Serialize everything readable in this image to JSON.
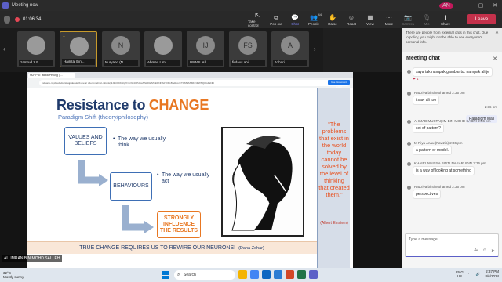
{
  "window": {
    "title": "Meeting now",
    "avatar_initials": "AN",
    "controls": [
      "—",
      "▢",
      "✕"
    ]
  },
  "toolbar": {
    "timer": "01:06:34",
    "buttons": [
      {
        "label": "Take control",
        "icon": "take-control-icon",
        "glyph": "⇱"
      },
      {
        "label": "Pop out",
        "icon": "pop-out-icon",
        "glyph": "⧉"
      },
      {
        "label": "Chat",
        "icon": "chat-icon",
        "glyph": "💬",
        "active": true
      },
      {
        "label": "People",
        "icon": "people-icon",
        "glyph": "👥",
        "badge": "44"
      },
      {
        "label": "Raise",
        "icon": "raise-hand-icon",
        "glyph": "✋"
      },
      {
        "label": "React",
        "icon": "react-icon",
        "glyph": "☺"
      },
      {
        "label": "View",
        "icon": "view-icon",
        "glyph": "▦"
      },
      {
        "label": "More",
        "icon": "more-icon",
        "glyph": "⋯"
      },
      {
        "label": "Camera",
        "icon": "camera-icon",
        "glyph": "📷",
        "dim": true
      },
      {
        "label": "Mic",
        "icon": "mic-icon",
        "glyph": "🎙",
        "dim": true
      },
      {
        "label": "Share",
        "icon": "share-icon",
        "glyph": "⬆"
      }
    ],
    "leave_label": "Leave"
  },
  "participants": [
    {
      "name": "zamrud Z.F...",
      "initials": "",
      "speaking": false
    },
    {
      "name": "Hairizal Bin...",
      "initials": "",
      "speaking": true,
      "hand": "1"
    },
    {
      "name": "Nuryahd (N...",
      "initials": "N",
      "speaking": false
    },
    {
      "name": "Ahmad Lim...",
      "initials": "",
      "speaking": false
    },
    {
      "name": "ISMAIL All...",
      "initials": "IJ",
      "speaking": false
    },
    {
      "name": "firdaus abi...",
      "initials": "FS",
      "speaking": false
    },
    {
      "name": "Azhari",
      "initials": "A",
      "speaking": false
    }
  ],
  "browser": {
    "tab": "NUYPro: Istiwa Perung | ...",
    "url": "ndeans-mycloudedutrstaqpidecuiwtb.meta/ odenpn.ehmz-mfonts/j3JZb0OtK.zip?cm=9c4CPdmsNSLR4/TZmbDNNA0TON-BSdtpo==TOMWIZIMNNDWSQOG4ENH",
    "button": "Use Document Editor"
  },
  "slide": {
    "title_main": "Resistance to ",
    "title_accent": "CHANGE",
    "subtitle": "Paradigm Shift (theory/philosophy)",
    "box1": "VALUES AND BELIEFS",
    "bullet1": "The way we usually think",
    "box2": "BEHAVIOURS",
    "bullet2": "The way we usually act",
    "box3_line1": "STRONGLY",
    "box3_line2": "INFLUENCE",
    "box3_line3": "THE RESULTS",
    "quote": "“The problems that exist in the world today cannot be solved by the level of thinking that created them.”",
    "quote_author": "(Albert Einstein)",
    "banner": "TRUE CHANGE REQUIRES US TO REWIRE OUR NEURONS!",
    "banner_author": "(Dana Zohar)"
  },
  "presenter": "AU IMRAN BIN MOHD SALLEH",
  "side": {
    "notice": "There are people from external orgs in this chat. Due to policy, you might not be able to see everyone's personal info.",
    "chat_title": "Meeting chat",
    "messages": [
      {
        "sender": "",
        "time": "",
        "text": "saya tak nampak gambar tu. nampak ali je",
        "reaction": "❤ 1"
      },
      {
        "sender": "Radziva binti Mohamed",
        "time": "2:35 pm",
        "text": "i saw ali too"
      },
      {
        "sender": "",
        "time": "2:36 pm",
        "text": "Paradigm Mall",
        "self": true
      },
      {
        "sender": "AHMAD MUSTAQIM BIN MOHD SABRI",
        "time": "2:36 pm",
        "text": "set of pattern?"
      },
      {
        "sender": "M Riya Anau (Fawzia)",
        "time": "2:36 pm",
        "text": "a pattern or model."
      },
      {
        "sender": "KHAIRUNNISSA BINTI NASARUDIN",
        "time": "2:36 pm",
        "text": "is a way of looking at something"
      },
      {
        "sender": "Radziva binti Mohamed",
        "time": "2:36 pm",
        "text": "perspectives"
      }
    ],
    "compose_placeholder": "Type a message"
  },
  "taskbar": {
    "weather_temp": "32°C",
    "weather_desc": "Mostly sunny",
    "search_placeholder": "Search",
    "lang": "ENG",
    "region": "US",
    "time": "2:37 PM",
    "date": "8/6/2024"
  },
  "colors": {
    "accent": "#5b5fc7",
    "leave": "#c4314b",
    "slide_navy": "#1f3a6b",
    "slide_orange": "#e87722"
  }
}
